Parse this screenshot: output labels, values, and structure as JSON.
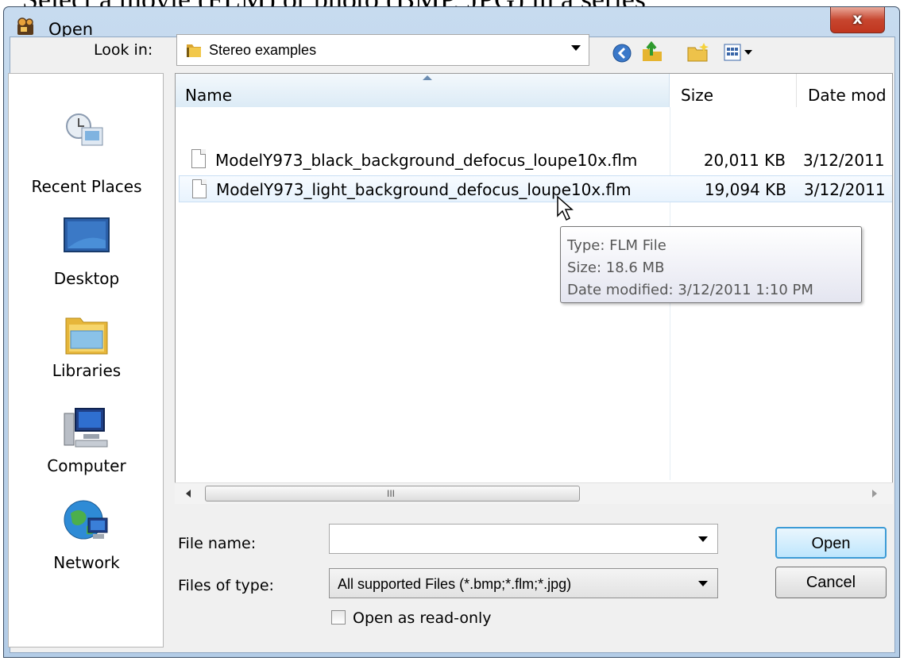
{
  "caption": "Select a movie (FLM) or photo (BMP, JPG) in a series",
  "window": {
    "title": "Open",
    "close_glyph": "x"
  },
  "toolbar": {
    "look_in_label": "Look in:",
    "look_in_value": "Stereo examples",
    "icons": [
      "back-icon",
      "up-folder-icon",
      "new-folder-icon",
      "view-menu-icon"
    ]
  },
  "places": [
    {
      "label": "Recent Places",
      "icon": "recent-places-icon"
    },
    {
      "label": "Desktop",
      "icon": "desktop-icon"
    },
    {
      "label": "Libraries",
      "icon": "libraries-icon"
    },
    {
      "label": "Computer",
      "icon": "computer-icon"
    },
    {
      "label": "Network",
      "icon": "network-icon"
    }
  ],
  "file_list": {
    "columns": [
      "Name",
      "Size",
      "Date mod"
    ],
    "rows": [
      {
        "name": "ModelY973_black_background_defocus_loupe10x.flm",
        "size": "20,011 KB",
        "date": "3/12/2011"
      },
      {
        "name": "ModelY973_light_background_defocus_loupe10x.flm",
        "size": "19,094 KB",
        "date": "3/12/2011"
      }
    ],
    "hover_row": 1
  },
  "tooltip": {
    "type": "Type: FLM File",
    "size": "Size: 18.6 MB",
    "date": "Date modified: 3/12/2011 1:10 PM"
  },
  "scrollbar": {
    "grip": "III"
  },
  "form": {
    "file_name_label": "File name:",
    "file_name_value": "",
    "files_of_type_label": "Files of type:",
    "files_of_type_value": "All supported Files (*.bmp;*.flm;*.jpg)",
    "read_only_label": "Open as read-only",
    "read_only_checked": false
  },
  "buttons": {
    "open": "Open",
    "cancel": "Cancel"
  }
}
